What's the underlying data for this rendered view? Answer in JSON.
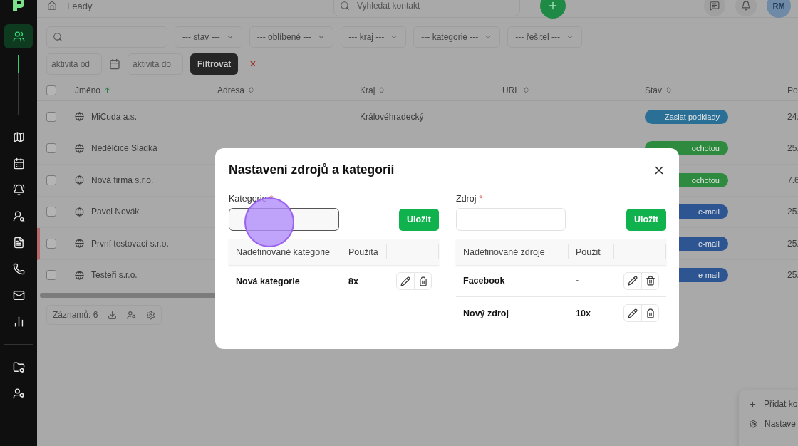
{
  "sidebar": {
    "items": [
      {
        "kind": "users",
        "selected": true
      },
      {
        "kind": "map",
        "selected": false
      },
      {
        "kind": "calendar",
        "selected": false
      },
      {
        "kind": "bell",
        "selected": false
      },
      {
        "kind": "user-key",
        "selected": false
      },
      {
        "kind": "document",
        "selected": false
      },
      {
        "kind": "phone",
        "selected": false
      },
      {
        "kind": "mail",
        "selected": false
      },
      {
        "kind": "chart",
        "selected": false
      }
    ],
    "bottom_items": [
      {
        "kind": "folder-settings",
        "selected": false
      },
      {
        "kind": "user-settings",
        "selected": false
      }
    ]
  },
  "topbar": {
    "breadcrumb": "Leady",
    "search": {
      "placeholder": "Vyhledat kontakt"
    },
    "avatar": "RM"
  },
  "filters": {
    "selects": [
      "--- stav ---",
      "--- oblíbené ---",
      "--- kraj ---",
      "--- kategorie ---",
      "--- řešitel ---"
    ],
    "date_from": {
      "placeholder": "aktivita od"
    },
    "date_to": {
      "placeholder": "aktivita do"
    },
    "filter_button": "Filtrovat",
    "clear": "×"
  },
  "table": {
    "columns": [
      "Jméno",
      "Adresa",
      "Kraj",
      "URL",
      "Stav",
      "Po"
    ],
    "rows": [
      {
        "name": "MiCuda a.s.",
        "region": "Královéhradecký",
        "status": "Zaslat podklady",
        "color": "#2a7096",
        "date": "24.",
        "flagged": false,
        "checked": false
      },
      {
        "name": "Nedělčice Sladká",
        "status": "ochotou",
        "color": "#2e8a3e",
        "date": "25.",
        "flagged": false,
        "checked": false
      },
      {
        "name": "Nová firma s.r.o.",
        "status": "ochotou",
        "color": "#2e8a3e",
        "date": "7.6",
        "flagged": false,
        "checked": false
      },
      {
        "name": "Pavel Novák",
        "status": "e-mail",
        "color": "#2c5592",
        "date": "25.",
        "flagged": false,
        "checked": false
      },
      {
        "name": "První testovací s.r.o.",
        "status": "e-mail",
        "color": "#2c5592",
        "date": "25.",
        "flagged": true,
        "checked": false
      },
      {
        "name": "Testeři s.r.o.",
        "status": "e-mail",
        "color": "#2c5592",
        "date": "25.",
        "flagged": false,
        "checked": false
      }
    ],
    "all_checked": false
  },
  "footer": {
    "count": "Záznamů: 6"
  },
  "popup_menu": [
    "Přidat ko",
    "Nastave"
  ],
  "dialog": {
    "title": "Nastavení zdrojů a kategorií",
    "panels": [
      {
        "label": "Kategorie",
        "required_mark": "*",
        "focused": true,
        "save": "Uložit",
        "columns": [
          "Nadefinované kategorie",
          "Použita"
        ],
        "rows": [
          {
            "name": "Nová kategorie",
            "used": "8x"
          }
        ]
      },
      {
        "label": "Zdroj",
        "required_mark": "*",
        "focused": false,
        "save": "Uložit",
        "columns": [
          "Nadefinované zdroje",
          "Použit"
        ],
        "rows": [
          {
            "name": "Facebook",
            "used": "-"
          },
          {
            "name": "Nový zdroj",
            "used": "10x"
          }
        ]
      }
    ]
  }
}
